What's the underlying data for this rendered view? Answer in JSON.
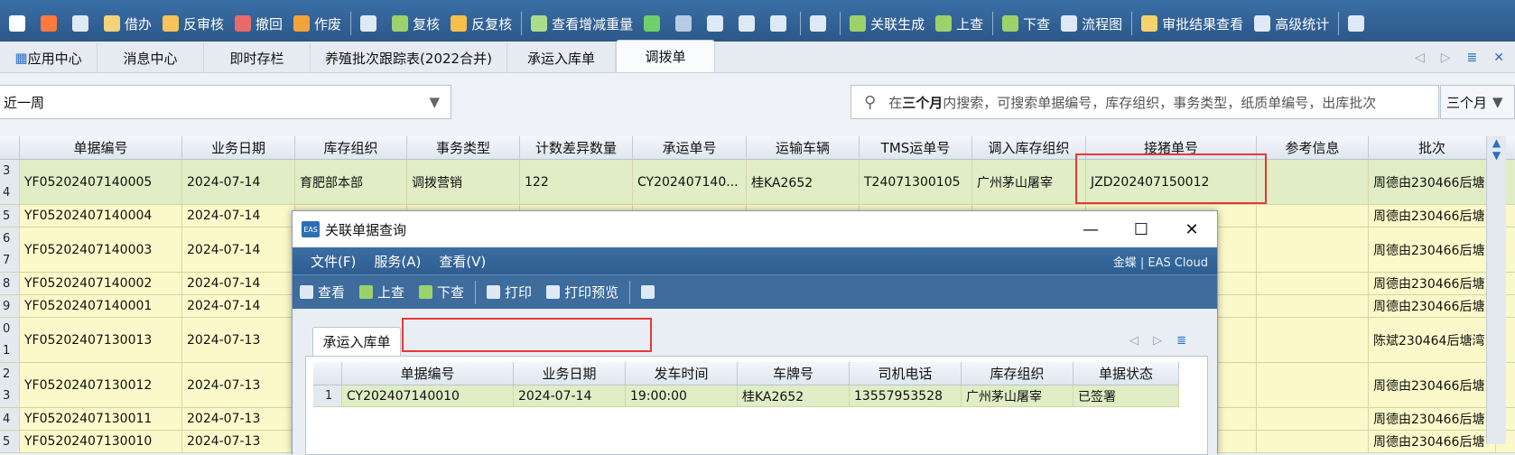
{
  "toolbar": {
    "items": [
      {
        "label": "",
        "icon": "edit-icon",
        "color": "#ffffff"
      },
      {
        "label": "",
        "icon": "delete-icon",
        "color": "#ff7a3d"
      },
      {
        "label": "",
        "icon": "preview-icon",
        "color": "#dfe9f5"
      },
      {
        "label": "借办",
        "icon": "borrow-icon",
        "color": "#f2d27a"
      },
      {
        "label": "反审核",
        "icon": "unaudit-icon",
        "color": "#f7c35b"
      },
      {
        "label": "撤回",
        "icon": "withdraw-icon",
        "color": "#e86a6a"
      },
      {
        "label": "作废",
        "icon": "void-icon",
        "color": "#f2a33a"
      },
      {
        "label": "",
        "icon": "view-icon",
        "color": "#dfe9f5"
      },
      {
        "label": "复核",
        "icon": "recheck-icon",
        "color": "#9bd36a"
      },
      {
        "label": "反复核",
        "icon": "unrecheck-icon",
        "color": "#f5c04a"
      },
      {
        "label": "查看增减重量",
        "icon": "weight-icon",
        "color": "#a9dd8c"
      },
      {
        "label": "",
        "icon": "refresh-icon",
        "color": "#6fcf6a"
      },
      {
        "label": "",
        "icon": "filter-icon",
        "color": "#b7cbe6"
      },
      {
        "label": "",
        "icon": "locate-icon",
        "color": "#dfe9f5"
      },
      {
        "label": "",
        "icon": "attach-icon",
        "color": "#dfe9f5"
      },
      {
        "label": "",
        "icon": "print-icon",
        "color": "#dfe9f5"
      },
      {
        "label": "",
        "icon": "print-preview-icon",
        "color": "#dfe9f5"
      },
      {
        "label": "关联生成",
        "icon": "link-generate-icon",
        "color": "#9bd36a"
      },
      {
        "label": "上查",
        "icon": "trace-up-icon",
        "color": "#9bd36a"
      },
      {
        "label": "下查",
        "icon": "trace-down-icon",
        "color": "#9bd36a"
      },
      {
        "label": "流程图",
        "icon": "flowchart-icon",
        "color": "#dfe9f5"
      },
      {
        "label": "审批结果查看",
        "icon": "approval-icon",
        "color": "#f5d36a"
      },
      {
        "label": "高级统计",
        "icon": "stats-icon",
        "color": "#dfe9f5"
      },
      {
        "label": "",
        "icon": "exit-icon",
        "color": "#dfe9f5"
      }
    ]
  },
  "tabs": [
    {
      "label": "应用中心",
      "active": false
    },
    {
      "label": "消息中心",
      "active": false
    },
    {
      "label": "即时存栏",
      "active": false
    },
    {
      "label": "养殖批次跟踪表(2022合并)",
      "active": false
    },
    {
      "label": "承运入库单",
      "active": false
    },
    {
      "label": "调拨单",
      "active": true
    }
  ],
  "filter": {
    "value": "近一周"
  },
  "search": {
    "prefix": "在",
    "bold": "三个月",
    "suffix": "内搜索，可搜索单据编号，库存组织，事务类型，纸质单编号，出库批次"
  },
  "period": {
    "value": "三个月"
  },
  "grid": {
    "columns": [
      "",
      "单据编号",
      "业务日期",
      "库存组织",
      "事务类型",
      "计数差异数量",
      "承运单号",
      "运输车辆",
      "TMS运单号",
      "调入库存组织",
      "接猪单号",
      "参考信息",
      "批次"
    ],
    "rows": [
      {
        "nums": [
          "3",
          "4"
        ],
        "cells": [
          "YF05202407140005",
          "2024-07-14",
          "育肥部本部",
          "调拨营销",
          "122",
          "CY202407140...",
          "桂KA2652",
          "T24071300105",
          "广州茅山屠宰",
          "JZD202407150012",
          "",
          "周德由230466后塘"
        ],
        "selected": true
      },
      {
        "nums": [
          "5"
        ],
        "cells": [
          "YF05202407140004",
          "2024-07-14",
          "",
          "",
          "",
          "",
          "",
          "",
          "",
          "",
          "",
          "周德由230466后塘"
        ],
        "selected": false
      },
      {
        "nums": [
          "6",
          "7"
        ],
        "cells": [
          "YF05202407140003",
          "2024-07-14",
          "",
          "",
          "",
          "",
          "",
          "",
          "",
          "",
          "",
          "周德由230466后塘"
        ],
        "selected": false
      },
      {
        "nums": [
          "8"
        ],
        "cells": [
          "YF05202407140002",
          "2024-07-14",
          "",
          "",
          "",
          "",
          "",
          "",
          "",
          "",
          "",
          "周德由230466后塘"
        ],
        "selected": false
      },
      {
        "nums": [
          "9"
        ],
        "cells": [
          "YF05202407140001",
          "2024-07-14",
          "",
          "",
          "",
          "",
          "",
          "",
          "",
          "",
          "",
          "周德由230466后塘"
        ],
        "selected": false
      },
      {
        "nums": [
          "0",
          "1"
        ],
        "cells": [
          "YF05202407130013",
          "2024-07-13",
          "",
          "",
          "",
          "",
          "",
          "",
          "",
          "",
          "",
          "陈斌230464后塘湾"
        ],
        "selected": false
      },
      {
        "nums": [
          "2",
          "3"
        ],
        "cells": [
          "YF05202407130012",
          "2024-07-13",
          "",
          "",
          "",
          "",
          "",
          "",
          "",
          "",
          "",
          "周德由230466后塘"
        ],
        "selected": false
      },
      {
        "nums": [
          "4"
        ],
        "cells": [
          "YF05202407130011",
          "2024-07-13",
          "",
          "",
          "",
          "",
          "",
          "",
          "",
          "",
          "",
          "周德由230466后塘"
        ],
        "selected": false
      },
      {
        "nums": [
          "5"
        ],
        "cells": [
          "YF05202407130010",
          "2024-07-13",
          "",
          "",
          "",
          "",
          "",
          "",
          "",
          "",
          "",
          "周德由230466后塘"
        ],
        "selected": false
      }
    ]
  },
  "dialog": {
    "title": "关联单据查询",
    "logo": "EAS",
    "menu": [
      "文件(F)",
      "服务(A)",
      "查看(V)"
    ],
    "brand": "金蝶 | EAS Cloud",
    "tools": [
      "查看",
      "上查",
      "下查",
      "打印",
      "打印预览",
      ""
    ],
    "subtab": "承运入库单",
    "columns": [
      "",
      "单据编号",
      "业务日期",
      "发车时间",
      "车牌号",
      "司机电话",
      "库存组织",
      "单据状态"
    ],
    "rows": [
      [
        "1",
        "CY202407140010",
        "2024-07-14",
        "19:00:00",
        "桂KA2652",
        "13557953528",
        "广州茅山屠宰",
        "已签署"
      ]
    ]
  }
}
